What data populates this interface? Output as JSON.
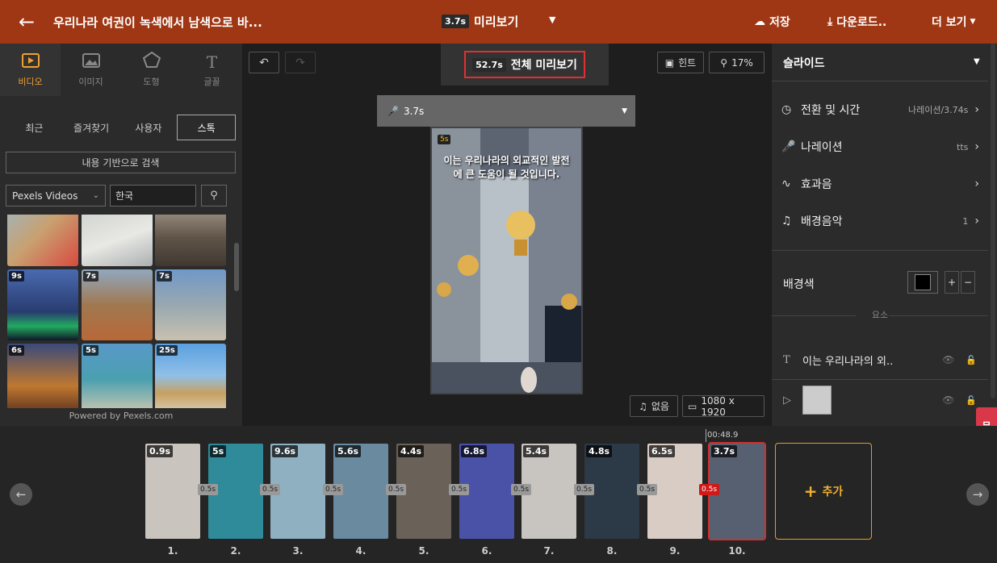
{
  "header": {
    "title": "우리나라 여권이 녹색에서 남색으로 바...",
    "preview_duration": "3.7s",
    "preview_label": "미리보기",
    "save_label": "저장",
    "download_label": "다운로드..",
    "more_label": "더 보기"
  },
  "left": {
    "media_tabs": [
      {
        "label": "비디오"
      },
      {
        "label": "이미지"
      },
      {
        "label": "도형"
      },
      {
        "label": "글꼴"
      }
    ],
    "category_tabs": [
      "최근",
      "즐겨찾기",
      "사용자",
      "스톡"
    ],
    "content_search": "내용 기반으로 검색",
    "provider": "Pexels Videos",
    "query": "한국",
    "thumbnails": [
      {
        "duration": ""
      },
      {
        "duration": ""
      },
      {
        "duration": ""
      },
      {
        "duration": "9s"
      },
      {
        "duration": "7s"
      },
      {
        "duration": "7s"
      },
      {
        "duration": "6s"
      },
      {
        "duration": "5s"
      },
      {
        "duration": "25s"
      }
    ],
    "powered": "Powered by Pexels.com"
  },
  "center": {
    "full_preview_duration": "52.7s",
    "full_preview_label": "전체 미리보기",
    "hint_label": "힌트",
    "zoom": "17%",
    "narration_duration": "3.7s",
    "slide_sound_badge": "5s",
    "caption": "이는 우리나라의 외교적인 발전에 큰 도움이 될 것입니다.",
    "music_label": "없음",
    "resolution": "1080 x 1920"
  },
  "right": {
    "heading": "슬라이드",
    "rows": [
      {
        "label": "전환 및 시간",
        "value": "나레이션/3.74s"
      },
      {
        "label": "나레이션",
        "value": "tts"
      },
      {
        "label": "효과음",
        "value": ""
      },
      {
        "label": "배경음악",
        "value": "1"
      }
    ],
    "bg_color_label": "배경색",
    "bg_color": "#000000",
    "elements_label": "요소",
    "elements": [
      {
        "label": "이는 우리나라의 외.."
      }
    ],
    "inquiry": "문의"
  },
  "timeline": {
    "playhead_time": "00:48.9",
    "slides": [
      {
        "num": "1.",
        "duration": "0.9s",
        "color": "#c9c4bd"
      },
      {
        "num": "2.",
        "duration": "5s",
        "color": "#2f8a9a"
      },
      {
        "num": "3.",
        "duration": "9.6s",
        "color": "#8fb0c0"
      },
      {
        "num": "4.",
        "duration": "5.6s",
        "color": "#6a8aa0"
      },
      {
        "num": "5.",
        "duration": "4.4s",
        "color": "#6a6258"
      },
      {
        "num": "6.",
        "duration": "6.8s",
        "color": "#4a52a8"
      },
      {
        "num": "7.",
        "duration": "5.4s",
        "color": "#c8c4c0"
      },
      {
        "num": "8.",
        "duration": "4.8s",
        "color": "#2c3a48"
      },
      {
        "num": "9.",
        "duration": "6.5s",
        "color": "#d8ccc4"
      },
      {
        "num": "10.",
        "duration": "3.7s",
        "color": "#566070"
      }
    ],
    "transitions": [
      "0.5s",
      "0.5s",
      "0.5s",
      "0.5s",
      "0.5s",
      "0.5s",
      "0.5s",
      "0.5s",
      "0.5s"
    ],
    "add_label": "추가"
  }
}
